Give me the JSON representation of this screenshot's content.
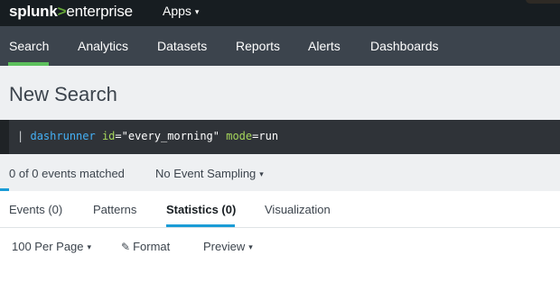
{
  "topbar": {
    "logo": {
      "part1": "splunk",
      "part2": ">",
      "part3": "enterprise"
    },
    "apps_menu": "Apps",
    "caret_icon": "▾",
    "colors": {
      "background": "#171d21",
      "logo_accent": "#65a637"
    }
  },
  "nav": {
    "tabs": [
      "Search",
      "Analytics",
      "Datasets",
      "Reports",
      "Alerts",
      "Dashboards"
    ],
    "active_tab": "Search",
    "colors": {
      "background": "#3c444d",
      "active_indicator": "#5cc05c"
    }
  },
  "search": {
    "page_title": "New Search",
    "query": {
      "pipe": "|",
      "command": "dashrunner",
      "arg1_name": "id",
      "arg1_value": "=\"every_morning\"",
      "arg2_name": "mode",
      "arg2_value": "=run"
    },
    "status": "0 of 0 events matched",
    "sampling": "No Event Sampling"
  },
  "results": {
    "tabs": [
      "Events (0)",
      "Patterns",
      "Statistics (0)",
      "Visualization"
    ],
    "active_tab": "Statistics (0)",
    "controls": {
      "per_page": "100 Per Page",
      "format": "Format",
      "preview": "Preview"
    },
    "colors": {
      "accent": "#1a9cd6"
    }
  }
}
